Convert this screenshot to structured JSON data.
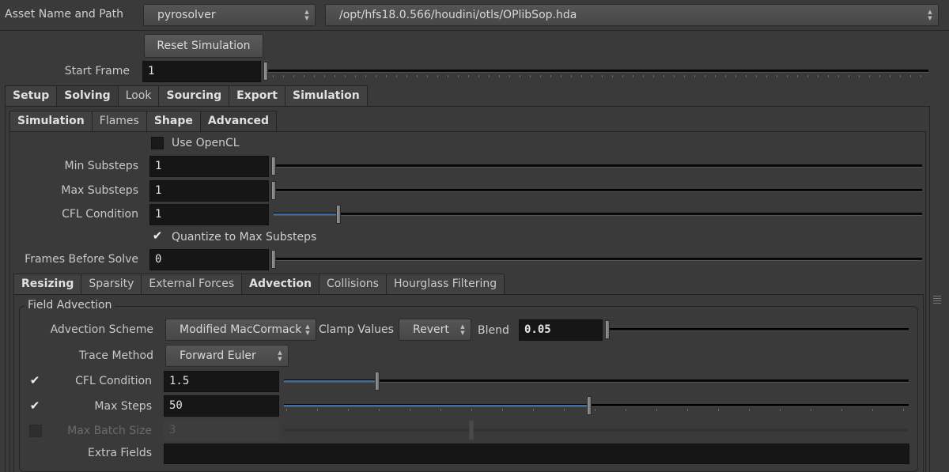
{
  "asset": {
    "label": "Asset Name and Path",
    "name": "pyrosolver",
    "path": "/opt/hfs18.0.566/houdini/otls/OPlibSop.hda"
  },
  "reset_button": "Reset Simulation",
  "start_frame": {
    "label": "Start Frame",
    "value": "1"
  },
  "main_tabs": [
    "Setup",
    "Solving",
    "Look",
    "Sourcing",
    "Export",
    "Simulation"
  ],
  "sub_tabs": [
    "Simulation",
    "Flames",
    "Shape",
    "Advanced"
  ],
  "use_opencl": {
    "label": "Use OpenCL",
    "checked": false
  },
  "min_substeps": {
    "label": "Min Substeps",
    "value": "1"
  },
  "max_substeps": {
    "label": "Max Substeps",
    "value": "1"
  },
  "cfl_condition_top": {
    "label": "CFL Condition",
    "value": "1"
  },
  "quantize": {
    "label": "Quantize to Max Substeps",
    "checked": true
  },
  "frames_before_solve": {
    "label": "Frames Before Solve",
    "value": "0"
  },
  "adv_tabs": [
    "Resizing",
    "Sparsity",
    "External Forces",
    "Advection",
    "Collisions",
    "Hourglass Filtering"
  ],
  "field_advection": {
    "title": "Field Advection",
    "scheme_label": "Advection Scheme",
    "scheme_value": "Modified MacCormack",
    "clamp_label": "Clamp Values",
    "clamp_value": "Revert",
    "blend_label": "Blend",
    "blend_value": "0.05",
    "trace_label": "Trace Method",
    "trace_value": "Forward Euler",
    "cfl_label": "CFL Condition",
    "cfl_value": "1.5",
    "cfl_enabled": true,
    "max_steps_label": "Max Steps",
    "max_steps_value": "50",
    "max_steps_enabled": true,
    "batch_label": "Max Batch Size",
    "batch_value": "3",
    "batch_enabled": false,
    "extra_label": "Extra Fields",
    "extra_value": ""
  },
  "colors": {
    "background": "#3a3a3a",
    "field": "#161616",
    "slider_fill": "#3c6ea8"
  },
  "icons": {
    "menu_arrows": "up-down-arrows-icon",
    "check": "checkmark-icon",
    "grip": "resize-grip-icon"
  }
}
